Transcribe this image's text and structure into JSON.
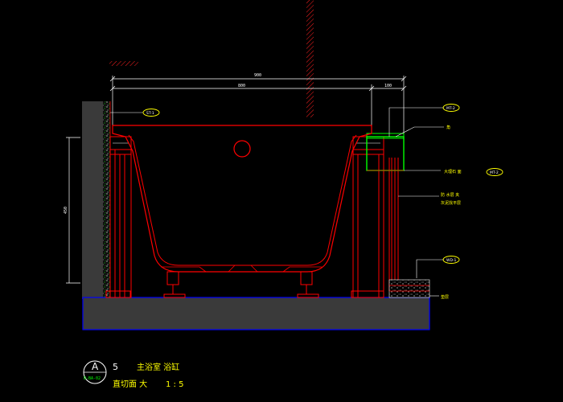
{
  "dimensions": {
    "overall_width": "900",
    "inner_width": "800",
    "side_width": "100",
    "height": "450"
  },
  "tags": {
    "left_wall": "ST-1",
    "top_right": "MT-2",
    "mid_right": "MT-2",
    "lower_right": "WD-1"
  },
  "notes": {
    "top_edge": "角",
    "marble_label": "大理石 面",
    "waterproof_line1": "防 水层 夹",
    "waterproof_line2": "灰泥找平层",
    "floor_label": "垫层"
  },
  "title_block": {
    "circle_letter": "A",
    "sheet_ref": "D-BA-02",
    "number": "5",
    "room_name": "主浴室 浴缸",
    "section_name": "直切面 大",
    "scale": "1 : 5"
  },
  "colors": {
    "background": "#000000",
    "outline": "#ff0000",
    "wall_fill": "#3a3a3a",
    "bubble": "#ffff00",
    "leader": "#ffffff",
    "title": "#ffff00",
    "floor_border": "#0000ff",
    "green_cap": "#00ff00"
  }
}
